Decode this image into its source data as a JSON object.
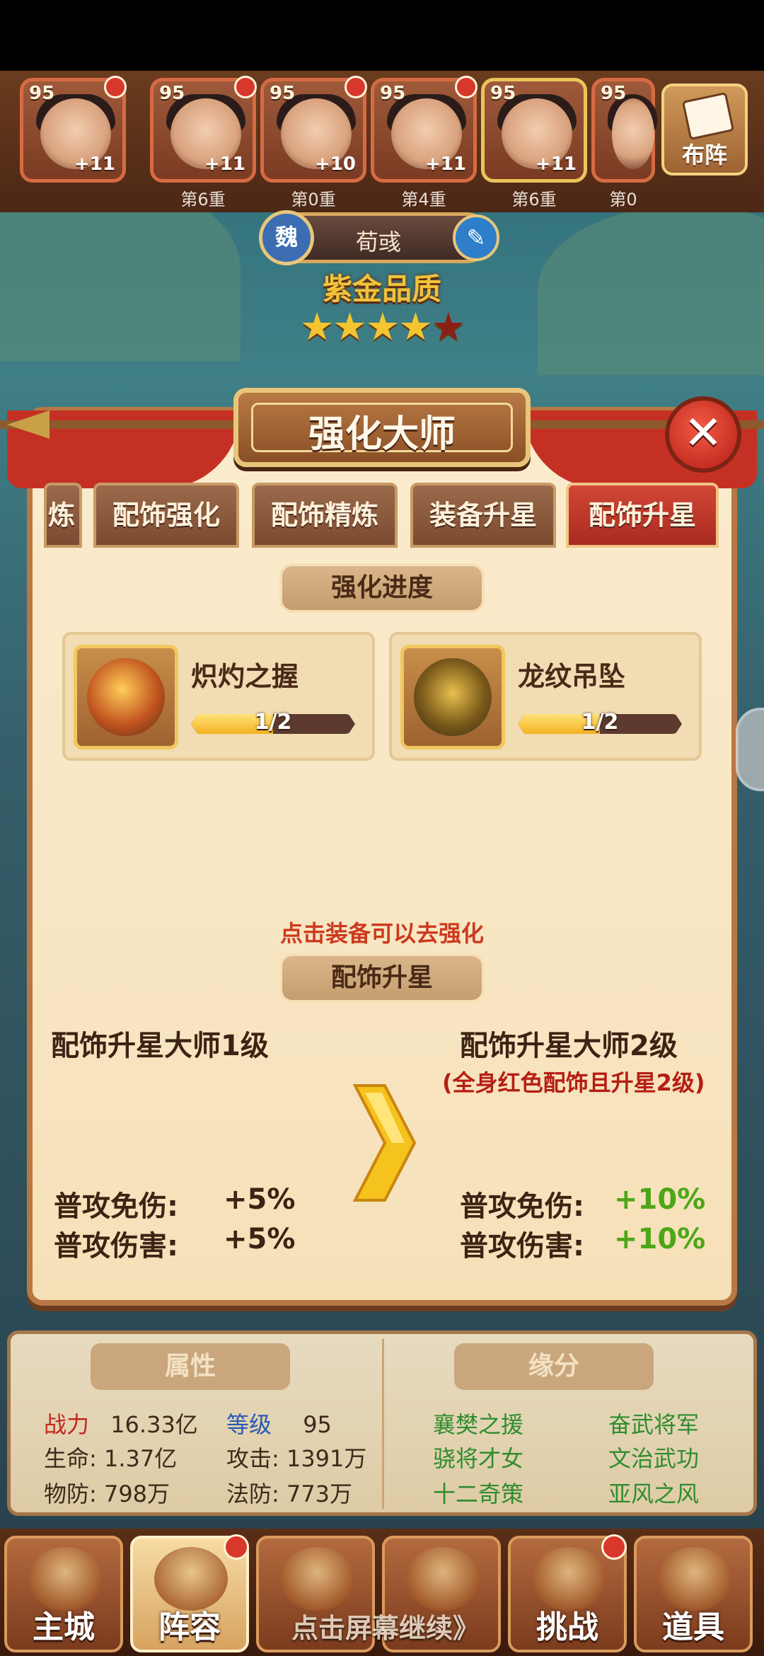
{
  "heroes": [
    {
      "level": "95",
      "plus": "+11",
      "layer": ""
    },
    {
      "level": "95",
      "plus": "+11",
      "layer": "第6重"
    },
    {
      "level": "95",
      "plus": "+10",
      "layer": "第0重"
    },
    {
      "level": "95",
      "plus": "+11",
      "layer": "第4重"
    },
    {
      "level": "95",
      "plus": "+11",
      "layer": "第6重"
    },
    {
      "level": "95",
      "plus": "",
      "layer": "第0"
    }
  ],
  "deploy_label": "布阵",
  "hero_info": {
    "kingdom": "魏",
    "name": "荀彧",
    "quality": "紫金品质",
    "stars_total": 5,
    "stars_gold": 4
  },
  "panel": {
    "title": "强化大师",
    "tabs": [
      "炼",
      "配饰强化",
      "配饰精炼",
      "装备升星",
      "配饰升星"
    ],
    "active_tab": 4,
    "progress_title": "强化进度",
    "items": [
      {
        "name": "炽灼之握",
        "progress_text": "1/2",
        "progress": 0.5,
        "icon": "fire-ring-icon"
      },
      {
        "name": "龙纹吊坠",
        "progress_text": "1/2",
        "progress": 0.5,
        "icon": "dragon-pendant-icon"
      }
    ],
    "hint": "点击装备可以去强化",
    "section_title": "配饰升星",
    "current_level": "配饰升星大师1级",
    "next_level": "配饰升星大师2级",
    "next_condition": "(全身红色配饰且升星2级)",
    "current_stats": [
      {
        "label": "普攻免伤:",
        "value": "+5%"
      },
      {
        "label": "普攻伤害:",
        "value": "+5%"
      }
    ],
    "next_stats": [
      {
        "label": "普攻免伤:",
        "value": "+10%"
      },
      {
        "label": "普攻伤害:",
        "value": "+10%"
      }
    ]
  },
  "attributes": {
    "header": "属性",
    "power_label": "战力",
    "power": "16.33亿",
    "level_label": "等级",
    "level": "95",
    "hp": "生命: 1.37亿",
    "atk": "攻击: 1391万",
    "pdef": "物防: 798万",
    "mdef": "法防: 773万"
  },
  "fate": {
    "header": "缘分",
    "items": [
      "襄樊之援",
      "奋武将军",
      "骁将才女",
      "文治武功",
      "十二奇策",
      "亚风之风"
    ]
  },
  "nav": {
    "items": [
      "主城",
      "阵容",
      "",
      "",
      "挑战",
      "道具"
    ],
    "continue_text": "点击屏幕继续》"
  },
  "colors": {
    "accent_red": "#c43124",
    "bonus_green": "#4da617",
    "condition_red": "#b51e13"
  }
}
